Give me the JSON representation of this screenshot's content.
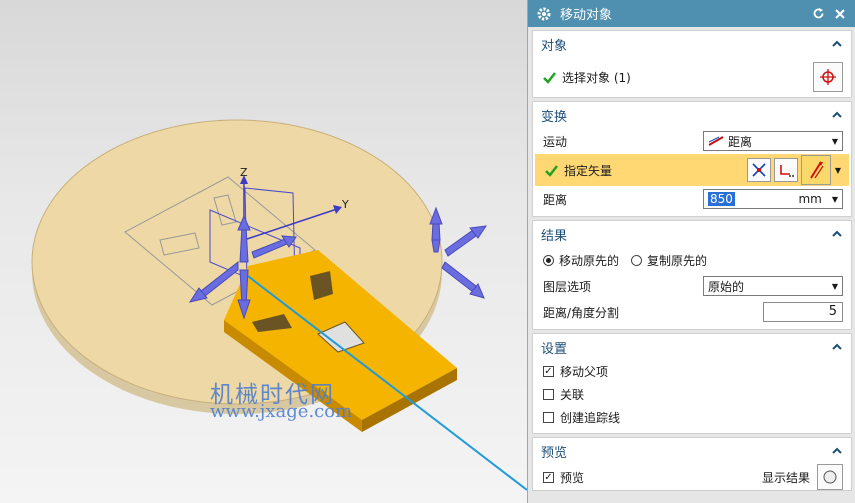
{
  "viewport": {
    "watermark_cn": "机械时代网",
    "watermark_url": "www.jxage.com",
    "axis_z": "Z",
    "axis_y": "Y",
    "colors": {
      "disc": "#eed8a5",
      "plate": "#f4b400",
      "vector_line": "#1f9bd8",
      "handle": "#6a6de0"
    }
  },
  "dialog": {
    "title": "移动对象",
    "object_group": {
      "header": "对象",
      "select_label": "选择对象 (1)"
    },
    "transform_group": {
      "header": "变换",
      "motion_label": "运动",
      "motion_value": "距离",
      "vector_label": "指定矢量",
      "distance_label": "距离",
      "distance_value": "850",
      "distance_unit": "mm"
    },
    "result_group": {
      "header": "结果",
      "move_original": "移动原先的",
      "copy_original": "复制原先的",
      "layer_label": "图层选项",
      "layer_value": "原始的",
      "split_label": "距离/角度分割",
      "split_value": "5"
    },
    "settings_group": {
      "header": "设置",
      "move_parent": "移动父项",
      "associate": "关联",
      "trace_lines": "创建追踪线"
    },
    "preview_group": {
      "header": "预览",
      "preview_label": "预览",
      "show_result": "显示结果"
    }
  }
}
